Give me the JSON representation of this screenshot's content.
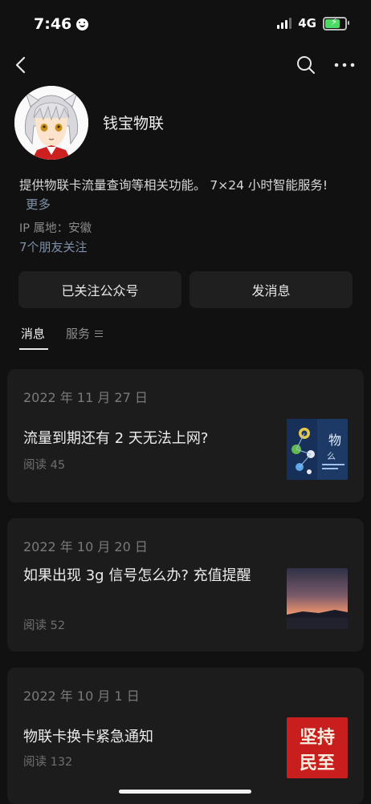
{
  "status_bar": {
    "time": "7:46",
    "network": "4G"
  },
  "account": {
    "name": "钱宝物联",
    "description": "提供物联卡流量查询等相关功能。 7×24 小时智能服务!",
    "more_label": "更多",
    "ip_location": "IP 属地：安徽",
    "friends_following": "7个朋友关注"
  },
  "actions": {
    "followed_label": "已关注公众号",
    "message_label": "发消息"
  },
  "tabs": [
    {
      "label": "消息",
      "active": true
    },
    {
      "label": "服务",
      "active": false
    }
  ],
  "articles": [
    {
      "date": "2022 年 11 月 27 日",
      "title": "流量到期还有 2 天无法上网?",
      "reads": "阅读 45",
      "thumb_icon": "iot-app-thumbnail",
      "thumb_text": [
        "物",
        "么"
      ]
    },
    {
      "date": "2022 年 10 月 20 日",
      "title": "如果出现 3g 信号怎么办? 充值提醒",
      "reads": "阅读 52",
      "thumb_icon": "sunset-thumbnail"
    },
    {
      "date": "2022 年 10 月 1 日",
      "title": "物联卡换卡紧急通知",
      "reads": "阅读 132",
      "thumb_icon": "red-calligraphy-thumbnail",
      "thumb_text": [
        "坚持",
        "民至"
      ]
    }
  ],
  "colors": {
    "background": "#111111",
    "card": "#1c1c1c",
    "link": "#7d90a9",
    "battery": "#4cd964"
  }
}
